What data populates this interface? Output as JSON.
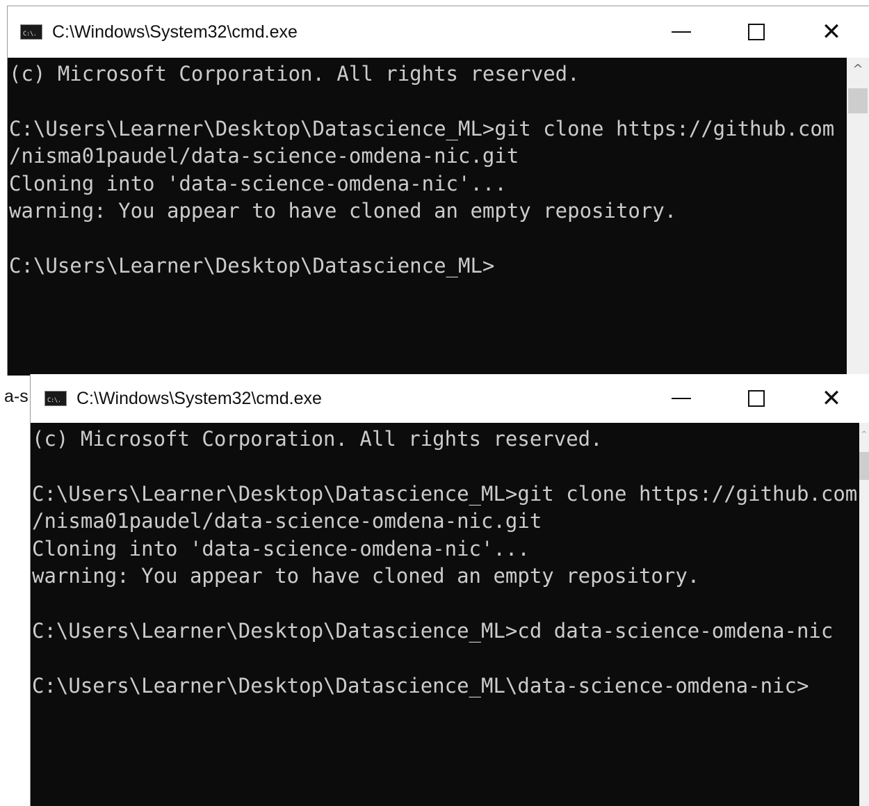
{
  "window_back": {
    "title": "C:\\Windows\\System32\\cmd.exe",
    "icon": "cmd-icon",
    "icon_label": "C:\\.",
    "controls": {
      "minimize_icon": "minimize-icon",
      "maximize_icon": "maximize-icon",
      "close_glyph": "✕"
    },
    "lines": [
      "(c) Microsoft Corporation. All rights reserved.",
      "",
      "C:\\Users\\Learner\\Desktop\\Datascience_ML>git clone https://github.com",
      "/nisma01paudel/data-science-omdena-nic.git",
      "Cloning into 'data-science-omdena-nic'...",
      "warning: You appear to have cloned an empty repository.",
      "",
      "C:\\Users\\Learner\\Desktop\\Datascience_ML>"
    ],
    "scroll_up_glyph": "^"
  },
  "window_front": {
    "title": "C:\\Windows\\System32\\cmd.exe",
    "icon": "cmd-icon",
    "icon_label": "C:\\.",
    "controls": {
      "minimize_icon": "minimize-icon",
      "maximize_icon": "maximize-icon",
      "close_glyph": "✕"
    },
    "lines": [
      "(c) Microsoft Corporation. All rights reserved.",
      "",
      "C:\\Users\\Learner\\Desktop\\Datascience_ML>git clone https://github.com",
      "/nisma01paudel/data-science-omdena-nic.git",
      "Cloning into 'data-science-omdena-nic'...",
      "warning: You appear to have cloned an empty repository.",
      "",
      "C:\\Users\\Learner\\Desktop\\Datascience_ML>cd data-science-omdena-nic",
      "",
      "C:\\Users\\Learner\\Desktop\\Datascience_ML\\data-science-omdena-nic>"
    ],
    "scroll_up_glyph": "^"
  },
  "background_fragment": {
    "text": "a-s"
  },
  "colors": {
    "console_bg": "#0c0c0c",
    "console_text": "#cccccc",
    "titlebar_bg": "#ffffff",
    "scrollbar_bg": "#f0f0f0"
  }
}
